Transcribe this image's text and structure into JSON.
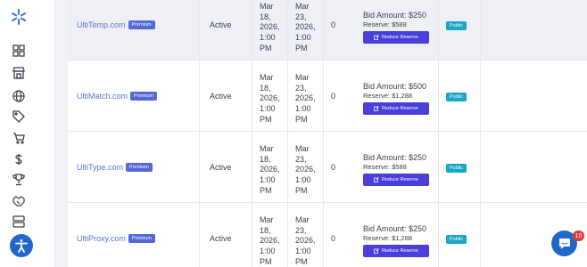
{
  "sidebar": {
    "icons": [
      "logo-icon",
      "grid-icon",
      "store-icon",
      "globe-icon",
      "tag-icon",
      "cart-icon",
      "dollar-icon",
      "trophy-icon",
      "handshake-icon",
      "server-icon"
    ]
  },
  "rows": [
    {
      "domain": "UltiTemp.com",
      "badge": "Premium",
      "status": "Active",
      "start": [
        "Mar",
        "18,",
        "2026,",
        "1:00",
        "PM"
      ],
      "end": [
        "Mar",
        "23,",
        "2026,",
        "1:00",
        "PM"
      ],
      "bids": "0",
      "bid_amount": "Bid Amount: $250",
      "reserve": "Reserve: $588",
      "button": "Reduce Reserve",
      "visibility": "Public"
    },
    {
      "domain": "UltiMatch.com",
      "badge": "Premium",
      "status": "Active",
      "start": [
        "Mar",
        "18,",
        "2026,",
        "1:00",
        "PM"
      ],
      "end": [
        "Mar",
        "23,",
        "2026,",
        "1:00",
        "PM"
      ],
      "bids": "0",
      "bid_amount": "Bid Amount: $500",
      "reserve": "Reserve: $1,288",
      "button": "Reduce Reserve",
      "visibility": "Public"
    },
    {
      "domain": "UltiType.com",
      "badge": "Premium",
      "status": "Active",
      "start": [
        "Mar",
        "18,",
        "2026,",
        "1:00",
        "PM"
      ],
      "end": [
        "Mar",
        "23,",
        "2026,",
        "1:00",
        "PM"
      ],
      "bids": "0",
      "bid_amount": "Bid Amount: $250",
      "reserve": "Reserve: $588",
      "button": "Reduce Reserve",
      "visibility": "Public"
    },
    {
      "domain": "UltiProxy.com",
      "badge": "Premium",
      "status": "Active",
      "start": [
        "Mar",
        "18,",
        "2026,",
        "1:00",
        "PM"
      ],
      "end": [
        "Mar",
        "23,",
        "2026,",
        "1:00",
        "PM"
      ],
      "bids": "0",
      "bid_amount": "Bid Amount: $250",
      "reserve": "Reserve: $1,288",
      "button": "Reduce Reserve",
      "visibility": "Public"
    }
  ],
  "chat": {
    "unread": "10"
  },
  "colors": {
    "accent": "#4a3fdc",
    "premium": "#5468d9",
    "public": "#1aa6c7",
    "link": "#5b6fd6"
  }
}
